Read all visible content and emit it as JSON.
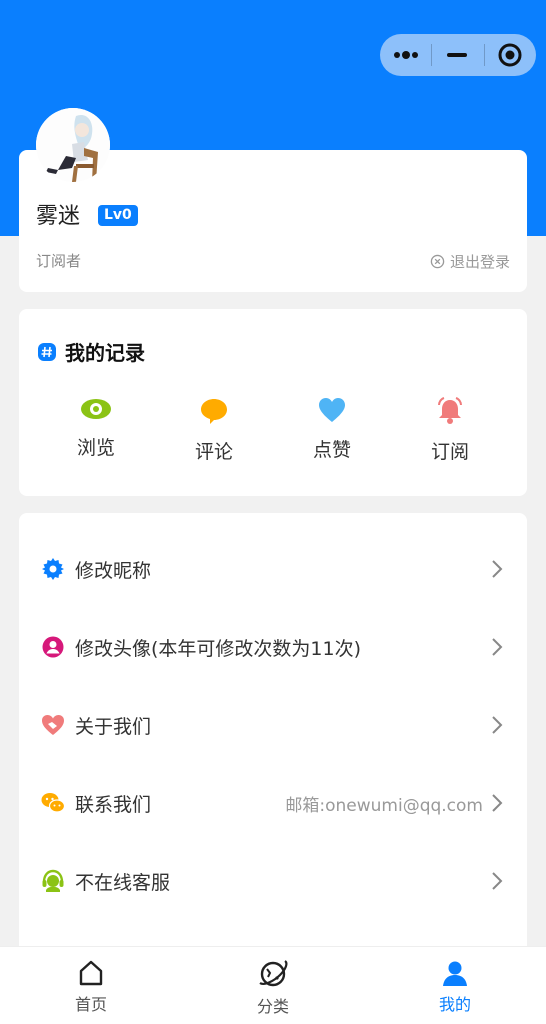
{
  "profile": {
    "username": "雾迷",
    "level": "Lv0",
    "role": "订阅者",
    "logout_label": "退出登录"
  },
  "records": {
    "title": "我的记录",
    "items": [
      {
        "label": "浏览",
        "icon": "eye-icon",
        "color": "#8bc315"
      },
      {
        "label": "评论",
        "icon": "comment-icon",
        "color": "#ffab00"
      },
      {
        "label": "点赞",
        "icon": "heart-icon",
        "color": "#4fb4f5"
      },
      {
        "label": "订阅",
        "icon": "bell-icon",
        "color": "#f07b7b"
      }
    ]
  },
  "menu": {
    "items": [
      {
        "label": "修改昵称",
        "icon": "gear-icon",
        "color": "#0a7ffe",
        "extra": ""
      },
      {
        "label": "修改头像(本年可修改次数为11次)",
        "icon": "user-circle-icon",
        "color": "#d6187a",
        "extra": ""
      },
      {
        "label": "关于我们",
        "icon": "heart-hand-icon",
        "color": "#f07b7b",
        "extra": ""
      },
      {
        "label": "联系我们",
        "icon": "wechat-icon",
        "color": "#ffab00",
        "extra": "邮箱:onewumi@qq.com"
      },
      {
        "label": "不在线客服",
        "icon": "headset-icon",
        "color": "#8bc315",
        "extra": ""
      }
    ]
  },
  "tabbar": {
    "tabs": [
      {
        "label": "首页",
        "icon": "home-icon"
      },
      {
        "label": "分类",
        "icon": "planet-icon"
      },
      {
        "label": "我的",
        "icon": "user-icon",
        "active": true
      }
    ]
  },
  "colors": {
    "brand": "#0a7ffe",
    "background": "#f1f1f1"
  }
}
